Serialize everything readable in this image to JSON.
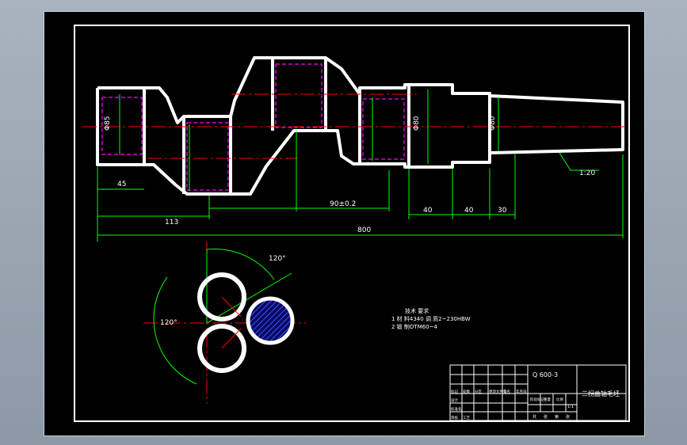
{
  "drawing": {
    "colors": {
      "background": "#000000",
      "outline": "#ffffff",
      "dimension": "#00ff00",
      "centerline": "#ff0000",
      "hidden": "#ff00ff",
      "hatch": "#2020ff",
      "annotation": "#ffff00"
    },
    "dimensions": {
      "d_left_end": "45",
      "d_total_113": "113",
      "d_pin_tol": "90±0.2",
      "d_small": "90±0.2",
      "d_step1": "40",
      "d_step2": "40",
      "d_step3": "30",
      "d_overall": "800",
      "d_dia_left": "Φ85",
      "d_dia_pin": "Φ85",
      "d_dia_shaft1": "Φ80",
      "d_dia_shaft2": "Φ80",
      "leader_label": "1:20",
      "angle_top": "120°",
      "angle_left": "120°"
    },
    "notes": {
      "heading": "技术 要求",
      "line1": "1  材 料4340 调 质2~230HBW",
      "line2": "2  锻 制OTM60~4"
    },
    "title_block": {
      "drawing_no": "Q 600-3",
      "part_name": "三拐曲轴毛坯",
      "scale": "1:1",
      "header_labels": [
        "标记",
        "处数",
        "分区",
        "更改文件号",
        "签名",
        "年月日"
      ],
      "row_labels": [
        "设计",
        "标准化",
        "审核",
        "工艺"
      ],
      "stage_labels": [
        "阶段标记",
        "重量",
        "比例"
      ],
      "footer_labels": [
        "共",
        "张",
        "第",
        "张"
      ]
    }
  }
}
